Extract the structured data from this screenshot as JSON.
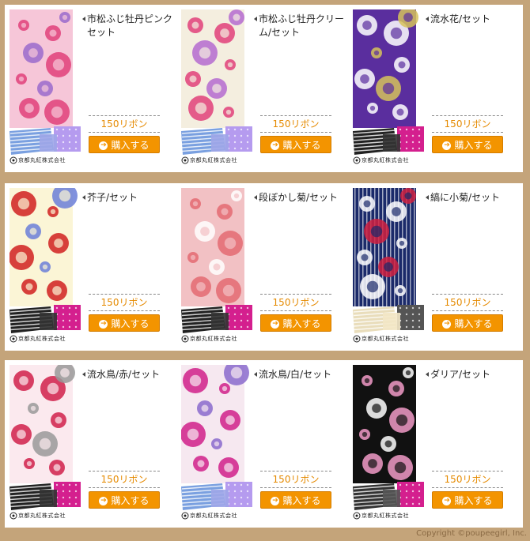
{
  "products": [
    {
      "title": "市松ふじ牡丹ピンクセット",
      "price": "150リボン",
      "buy_label": "購入する",
      "brand_label": "京都丸紅株式会社",
      "bg": "#f6c6d8",
      "fg": "#e0407a",
      "accent": "#9a6acc",
      "p1": "#9fa6e8",
      "p2": "#b59bef",
      "stripe": "#7aa0e0"
    },
    {
      "title": "市松ふじ牡丹クリーム/セット",
      "price": "150リボン",
      "buy_label": "購入する",
      "brand_label": "京都丸紅株式会社",
      "bg": "#f4eedf",
      "fg": "#e0407a",
      "accent": "#b46ad0",
      "p1": "#9fa6e8",
      "p2": "#b59bef",
      "stripe": "#7aa0e0"
    },
    {
      "title": "流水花/セット",
      "price": "150リボン",
      "buy_label": "購入する",
      "brand_label": "京都丸紅株式会社",
      "bg": "#5a2e9e",
      "fg": "#ffffff",
      "accent": "#d6c25a",
      "p1": "#333333",
      "p2": "#d41f8e",
      "stripe": "#222222"
    },
    {
      "title": "芥子/セット",
      "price": "150リボン",
      "buy_label": "購入する",
      "brand_label": "京都丸紅株式会社",
      "bg": "#fbf5d6",
      "fg": "#d02020",
      "accent": "#6a7ed8",
      "p1": "#333333",
      "p2": "#d41f8e",
      "stripe": "#222222"
    },
    {
      "title": "段ぼかし菊/セット",
      "price": "150リボン",
      "buy_label": "購入する",
      "brand_label": "京都丸紅株式会社",
      "bg": "#f2c1c4",
      "fg": "#e46a72",
      "accent": "#ffffff",
      "p1": "#333333",
      "p2": "#d41f8e",
      "stripe": "#222222"
    },
    {
      "title": "縞に小菊/セット",
      "price": "150リボン",
      "buy_label": "購入する",
      "brand_label": "京都丸紅株式会社",
      "bg": "#1b2a6a",
      "fg": "#ffffff",
      "accent": "#d02040",
      "p1": "#f3e7c6",
      "p2": "#555555",
      "stripe": "#e9ddbb"
    },
    {
      "title": "流水鳥/赤/セット",
      "price": "150リボン",
      "buy_label": "購入する",
      "brand_label": "京都丸紅株式会社",
      "bg": "#fbe9ee",
      "fg": "#d0204a",
      "accent": "#999999",
      "p1": "#333333",
      "p2": "#d41f8e",
      "stripe": "#222222"
    },
    {
      "title": "流水鳥/白/セット",
      "price": "150リボン",
      "buy_label": "購入する",
      "brand_label": "京都丸紅株式会社",
      "bg": "#f6e8f0",
      "fg": "#d0208a",
      "accent": "#8a6acc",
      "p1": "#9fa6e8",
      "p2": "#b59bef",
      "stripe": "#7aa0e0"
    },
    {
      "title": "ダリア/セット",
      "price": "150リボン",
      "buy_label": "購入する",
      "brand_label": "京都丸紅株式会社",
      "bg": "#111111",
      "fg": "#f29bc8",
      "accent": "#ffffff",
      "p1": "#555555",
      "p2": "#d41f8e",
      "stripe": "#333333"
    }
  ],
  "copyright": "Copyright ©poupeegirl, Inc."
}
